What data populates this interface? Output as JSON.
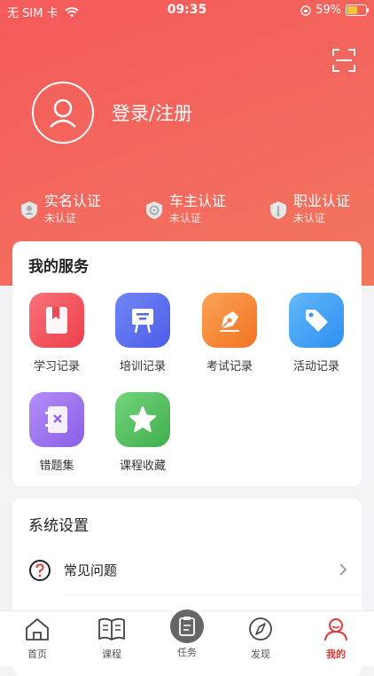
{
  "status_bar": {
    "carrier": "无 SIM 卡",
    "time": "09:35",
    "battery": "59%",
    "battery_level": 0.59
  },
  "user": {
    "login_label": "登录/注册"
  },
  "certifications": [
    {
      "title": "实名认证",
      "status": "未认证"
    },
    {
      "title": "车主认证",
      "status": "未认证"
    },
    {
      "title": "职业认证",
      "status": "未认证"
    }
  ],
  "services": {
    "title": "我的服务",
    "items": [
      {
        "label": "学习记录",
        "icon": "bookmark-book-icon",
        "color": "#f25560"
      },
      {
        "label": "培训记录",
        "icon": "presentation-board-icon",
        "color": "#5b6ef0"
      },
      {
        "label": "考试记录",
        "icon": "pen-nib-icon",
        "color": "#f5873a"
      },
      {
        "label": "活动记录",
        "icon": "tag-icon",
        "color": "#45a3f5"
      },
      {
        "label": "错题集",
        "icon": "notebook-x-icon",
        "color": "#9b6ff0"
      },
      {
        "label": "课程收藏",
        "icon": "star-icon",
        "color": "#54c25f"
      }
    ]
  },
  "settings": {
    "title": "系统设置",
    "items": [
      {
        "label": "常见问题",
        "icon": "question-circle-icon"
      }
    ]
  },
  "tabs": [
    {
      "label": "首页",
      "icon": "home-icon"
    },
    {
      "label": "课程",
      "icon": "book-icon"
    },
    {
      "label": "任务",
      "icon": "clipboard-icon"
    },
    {
      "label": "发现",
      "icon": "compass-icon"
    },
    {
      "label": "我的",
      "icon": "user-icon",
      "active": true
    }
  ],
  "colors": {
    "accent": "#e23838",
    "header": "#f45a5a"
  }
}
